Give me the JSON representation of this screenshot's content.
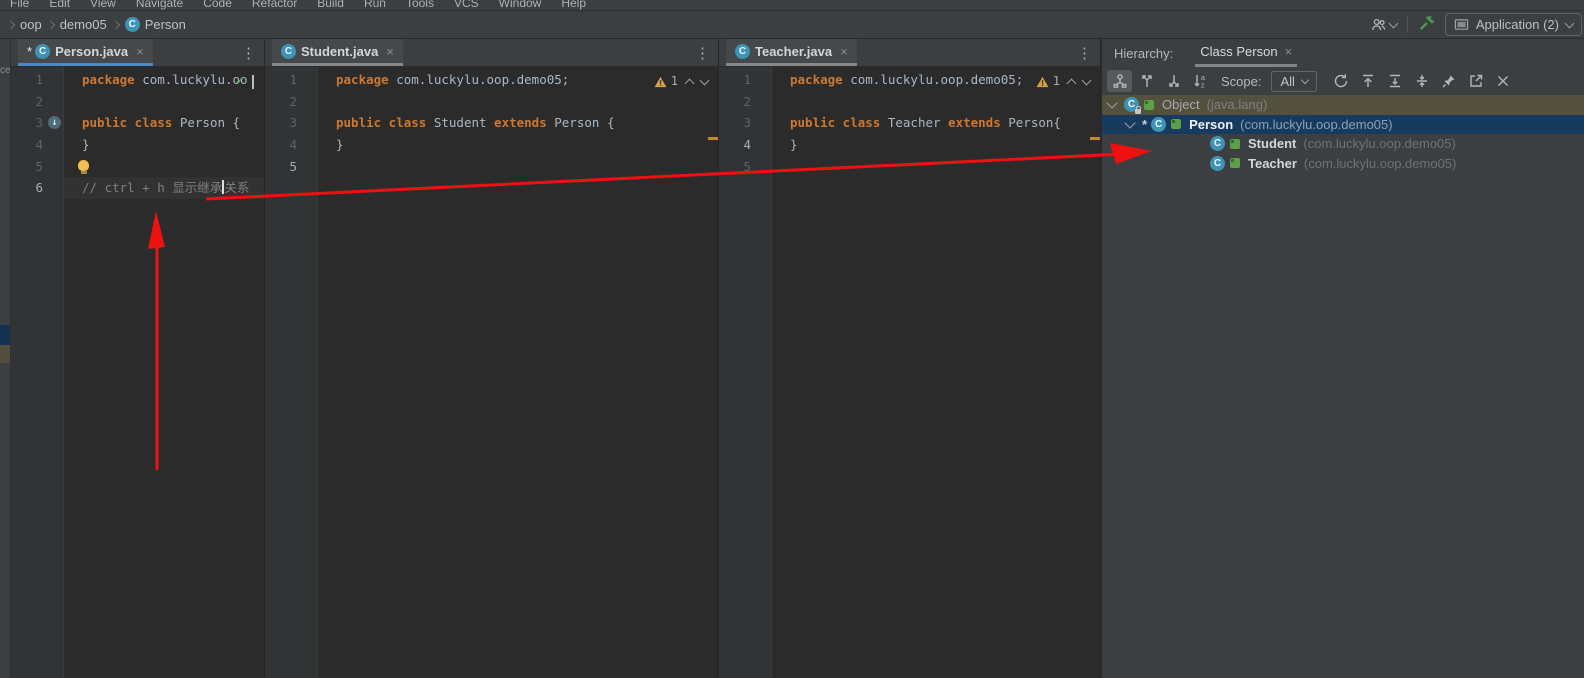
{
  "window": {
    "menu_items": [
      "File",
      "Edit",
      "View",
      "Navigate",
      "Code",
      "Refactor",
      "Build",
      "Run",
      "Tools",
      "VCS",
      "Window",
      "Help"
    ],
    "breadcrumbs": [
      "oop",
      "demo05",
      "Person"
    ],
    "left_stripe_fragment": "ce",
    "run_widget": {
      "config_label": "Application (2)"
    }
  },
  "editors": [
    {
      "tab": "Person.java",
      "modified": true,
      "focused": true,
      "current_line": 6,
      "right_widget": {
        "type": "ok"
      },
      "lines": [
        {
          "n": 1,
          "tokens": [
            [
              "kw",
              "package"
            ],
            [
              "pl",
              " com.luckylu.oo"
            ]
          ]
        },
        {
          "n": 2,
          "tokens": []
        },
        {
          "n": 3,
          "tokens": [
            [
              "kw",
              "public class"
            ],
            [
              "pl",
              " Person {"
            ]
          ],
          "gutter_icon": "subclassed-icon"
        },
        {
          "n": 4,
          "tokens": [
            [
              "pl",
              "}"
            ]
          ]
        },
        {
          "n": 5,
          "tokens": [],
          "bulb": true
        },
        {
          "n": 6,
          "tokens": [
            [
              "cm",
              "// ctrl + h 显示继承"
            ],
            [
              "caret",
              ""
            ],
            [
              "cm",
              "关系"
            ]
          ]
        }
      ]
    },
    {
      "tab": "Student.java",
      "modified": false,
      "focused": false,
      "current_line": 5,
      "right_widget": {
        "type": "warn",
        "count": "1"
      },
      "scroll_tick_y": 70,
      "lines": [
        {
          "n": 1,
          "tokens": [
            [
              "kw",
              "package"
            ],
            [
              "pl",
              " com.luckylu.oop.demo05;"
            ]
          ]
        },
        {
          "n": 2,
          "tokens": []
        },
        {
          "n": 3,
          "tokens": [
            [
              "kw",
              "public class"
            ],
            [
              "pl",
              " Student "
            ],
            [
              "kw",
              "extends"
            ],
            [
              "pl",
              " Person {"
            ]
          ]
        },
        {
          "n": 4,
          "tokens": [
            [
              "pl",
              "}"
            ]
          ]
        },
        {
          "n": 5,
          "tokens": []
        }
      ]
    },
    {
      "tab": "Teacher.java",
      "modified": false,
      "focused": false,
      "current_line": 4,
      "right_widget": {
        "type": "warn",
        "count": "1"
      },
      "scroll_tick_y": 70,
      "lines": [
        {
          "n": 1,
          "tokens": [
            [
              "kw",
              "package"
            ],
            [
              "pl",
              " com.luckylu.oop.demo05;"
            ]
          ]
        },
        {
          "n": 2,
          "tokens": []
        },
        {
          "n": 3,
          "tokens": [
            [
              "kw",
              "public class"
            ],
            [
              "pl",
              " Teacher "
            ],
            [
              "kw",
              "extends"
            ],
            [
              "pl",
              " Person{"
            ]
          ]
        },
        {
          "n": 4,
          "tokens": [
            [
              "pl",
              "}"
            ]
          ]
        },
        {
          "n": 5,
          "tokens": []
        }
      ]
    }
  ],
  "hierarchy": {
    "label": "Hierarchy:",
    "tab": "Class Person",
    "toolbar": {
      "left_icons": [
        "class-hierarchy-icon",
        "supertypes-hierarchy-icon",
        "subtypes-hierarchy-icon",
        "sort-alphabetically-icon"
      ],
      "selected_icon": "class-hierarchy-icon",
      "scope_label": "Scope:",
      "scope_value": "All",
      "right_icons": [
        "refresh-icon",
        "base-on-this-class-icon",
        "expand-all-icon",
        "collapse-all-icon",
        "pin-icon",
        "open-in-editor-icon",
        "close-icon"
      ]
    },
    "tree": [
      {
        "name": "Object",
        "pkg": "(java.lang)",
        "level": 0,
        "chevron": true,
        "final_lock": true,
        "row_style": "base"
      },
      {
        "name": "Person",
        "pkg": "(com.luckylu.oop.demo05)",
        "level": 1,
        "chevron": true,
        "star": true,
        "row_style": "selected"
      },
      {
        "name": "Student",
        "pkg": "(com.luckylu.oop.demo05)",
        "level": 2,
        "row_style": "normal"
      },
      {
        "name": "Teacher",
        "pkg": "(com.luckylu.oop.demo05)",
        "level": 2,
        "row_style": "normal"
      }
    ]
  },
  "colors": {
    "keyword": "#cc7832",
    "plain": "#a9b7c6",
    "comment": "#808080",
    "selection_row": "#173a5f",
    "base_row": "#53503e",
    "warn_tick": "#c8862a",
    "annotation": "#ee1111",
    "hammer": "#499C54"
  }
}
